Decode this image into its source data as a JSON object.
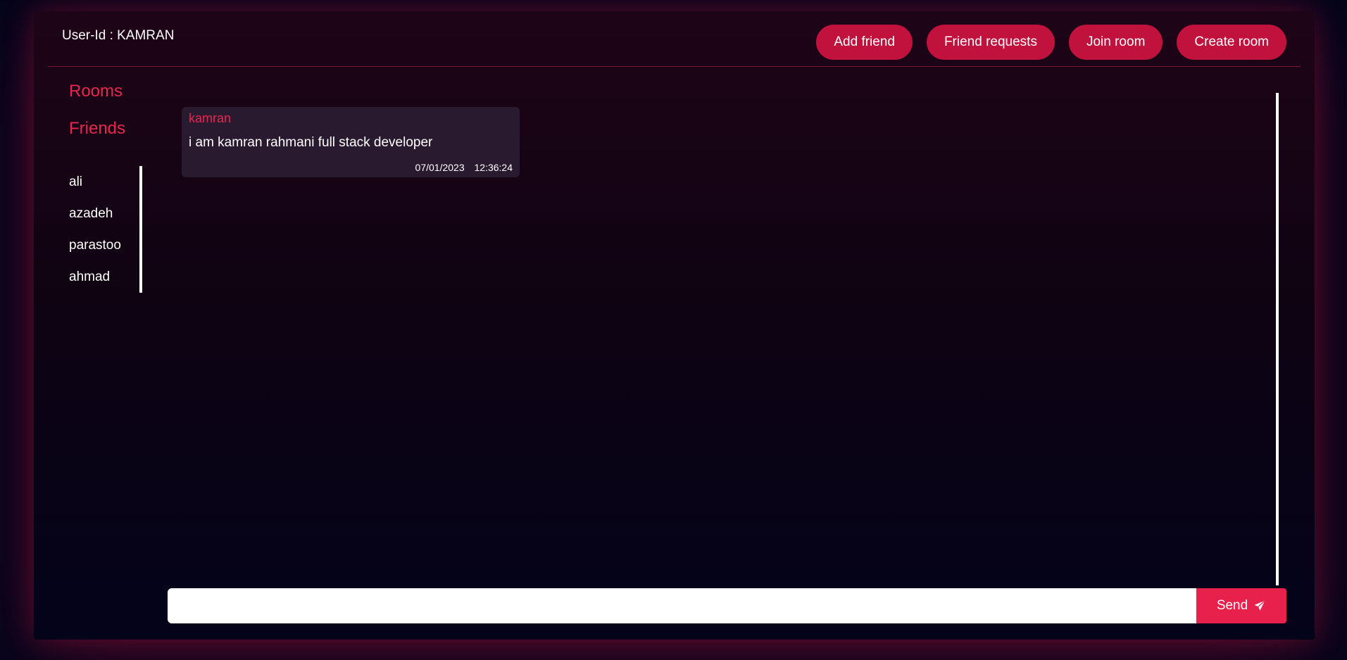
{
  "header": {
    "user_id": "User-Id : KAMRAN",
    "buttons": {
      "add_friend": "Add friend",
      "friend_requests": "Friend requests",
      "join_room": "Join room",
      "create_room": "Create room"
    }
  },
  "sidebar": {
    "rooms_heading": "Rooms",
    "friends_heading": "Friends",
    "friends": [
      "ali",
      "azadeh",
      "parastoo",
      "ahmad"
    ]
  },
  "messages": [
    {
      "author": "kamran",
      "text": "i am kamran rahmani full stack developer",
      "date": "07/01/2023",
      "time": "12:36:24"
    }
  ],
  "composer": {
    "value": "",
    "send_label": "Send",
    "send_icon": "paper-plane-icon"
  },
  "colors": {
    "accent": "#c0123d",
    "accent_text": "#e8264f",
    "background": "#04041a"
  }
}
